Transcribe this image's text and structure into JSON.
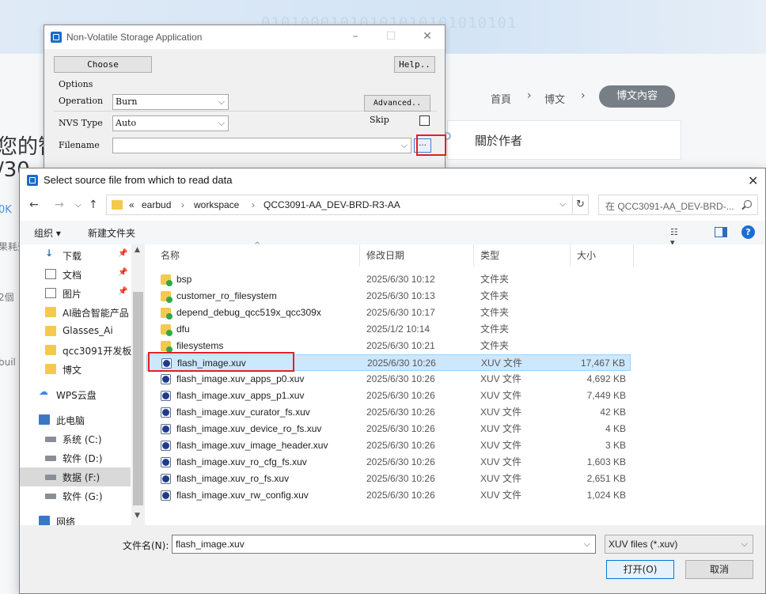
{
  "background": {
    "binary_text": "01010001010101010101010101",
    "left_fragments": [
      "您的智",
      "/30",
      "0K",
      "果耗費",
      "2個",
      "buil"
    ],
    "breadcrumb": [
      "首頁",
      "博文"
    ],
    "breadcrumb_active": "博文內容",
    "author_title": "關於作者"
  },
  "nvs_window": {
    "title": "Non-Volatile Storage Application",
    "choose_label": "Choose",
    "help_label": "Help..",
    "options_label": "Options",
    "operation_label": "Operation",
    "operation_value": "Burn",
    "nvs_type_label": "NVS Type",
    "nvs_type_value": "Auto",
    "filename_label": "Filename",
    "filename_value": "",
    "advanced_label": "Advanced..",
    "skip_label": "Skip",
    "browse_label": "..."
  },
  "dialog": {
    "title": "Select source file from which to read data",
    "address": {
      "overflow": "«",
      "segments": [
        "earbud",
        "workspace",
        "QCC3091-AA_DEV-BRD-R3-AA"
      ]
    },
    "search_placeholder": "在 QCC3091-AA_DEV-BRD-...",
    "toolbar": {
      "organize": "组织 ▾",
      "new_folder": "新建文件夹"
    },
    "nav_items": [
      {
        "label": "下载",
        "icon": "download-icon",
        "pin": true
      },
      {
        "label": "文档",
        "icon": "document-icon",
        "pin": true
      },
      {
        "label": "图片",
        "icon": "picture-icon",
        "pin": true
      },
      {
        "label": "AI融合智能产品",
        "icon": "folder-icon",
        "pin": false
      },
      {
        "label": "Glasses_Ai",
        "icon": "folder-icon",
        "pin": false
      },
      {
        "label": "qcc3091开发板",
        "icon": "folder-icon",
        "pin": false
      },
      {
        "label": "博文",
        "icon": "folder-icon",
        "pin": false
      },
      {
        "label": "WPS云盘",
        "icon": "cloud-icon",
        "pin": false
      },
      {
        "label": "此电脑",
        "icon": "computer-icon",
        "pin": false
      },
      {
        "label": "系统 (C:)",
        "icon": "drive-icon",
        "pin": false
      },
      {
        "label": "软件 (D:)",
        "icon": "drive-icon",
        "pin": false
      },
      {
        "label": "数据 (F:)",
        "icon": "drive-icon",
        "pin": false
      },
      {
        "label": "软件 (G:)",
        "icon": "drive-icon",
        "pin": false
      },
      {
        "label": "网络",
        "icon": "network-icon",
        "pin": false
      }
    ],
    "columns": [
      "名称",
      "修改日期",
      "类型",
      "大小"
    ],
    "files": [
      {
        "name": "bsp",
        "date": "2025/6/30 10:12",
        "type": "文件夹",
        "size": "",
        "kind": "folder"
      },
      {
        "name": "customer_ro_filesystem",
        "date": "2025/6/30 10:13",
        "type": "文件夹",
        "size": "",
        "kind": "folder"
      },
      {
        "name": "depend_debug_qcc519x_qcc309x",
        "date": "2025/6/30 10:17",
        "type": "文件夹",
        "size": "",
        "kind": "folder"
      },
      {
        "name": "dfu",
        "date": "2025/1/2 10:14",
        "type": "文件夹",
        "size": "",
        "kind": "folder"
      },
      {
        "name": "filesystems",
        "date": "2025/6/30 10:21",
        "type": "文件夹",
        "size": "",
        "kind": "folder"
      },
      {
        "name": "flash_image.xuv",
        "date": "2025/6/30 10:26",
        "type": "XUV 文件",
        "size": "17,467 KB",
        "kind": "file"
      },
      {
        "name": "flash_image.xuv_apps_p0.xuv",
        "date": "2025/6/30 10:26",
        "type": "XUV 文件",
        "size": "4,692 KB",
        "kind": "file"
      },
      {
        "name": "flash_image.xuv_apps_p1.xuv",
        "date": "2025/6/30 10:26",
        "type": "XUV 文件",
        "size": "7,449 KB",
        "kind": "file"
      },
      {
        "name": "flash_image.xuv_curator_fs.xuv",
        "date": "2025/6/30 10:26",
        "type": "XUV 文件",
        "size": "42 KB",
        "kind": "file"
      },
      {
        "name": "flash_image.xuv_device_ro_fs.xuv",
        "date": "2025/6/30 10:26",
        "type": "XUV 文件",
        "size": "4 KB",
        "kind": "file"
      },
      {
        "name": "flash_image.xuv_image_header.xuv",
        "date": "2025/6/30 10:26",
        "type": "XUV 文件",
        "size": "3 KB",
        "kind": "file"
      },
      {
        "name": "flash_image.xuv_ro_cfg_fs.xuv",
        "date": "2025/6/30 10:26",
        "type": "XUV 文件",
        "size": "1,603 KB",
        "kind": "file"
      },
      {
        "name": "flash_image.xuv_ro_fs.xuv",
        "date": "2025/6/30 10:26",
        "type": "XUV 文件",
        "size": "2,651 KB",
        "kind": "file"
      },
      {
        "name": "flash_image.xuv_rw_config.xuv",
        "date": "2025/6/30 10:26",
        "type": "XUV 文件",
        "size": "1,024 KB",
        "kind": "file"
      }
    ],
    "selected_file": "flash_image.xuv",
    "filename_label": "文件名(N):",
    "filename_value": "flash_image.xuv",
    "filetype_value": "XUV files (*.xuv)",
    "open_label": "打开(O)",
    "cancel_label": "取消"
  },
  "colors": {
    "highlight": "#e02020",
    "selection": "#cce8ff",
    "accent": "#0078d7"
  }
}
